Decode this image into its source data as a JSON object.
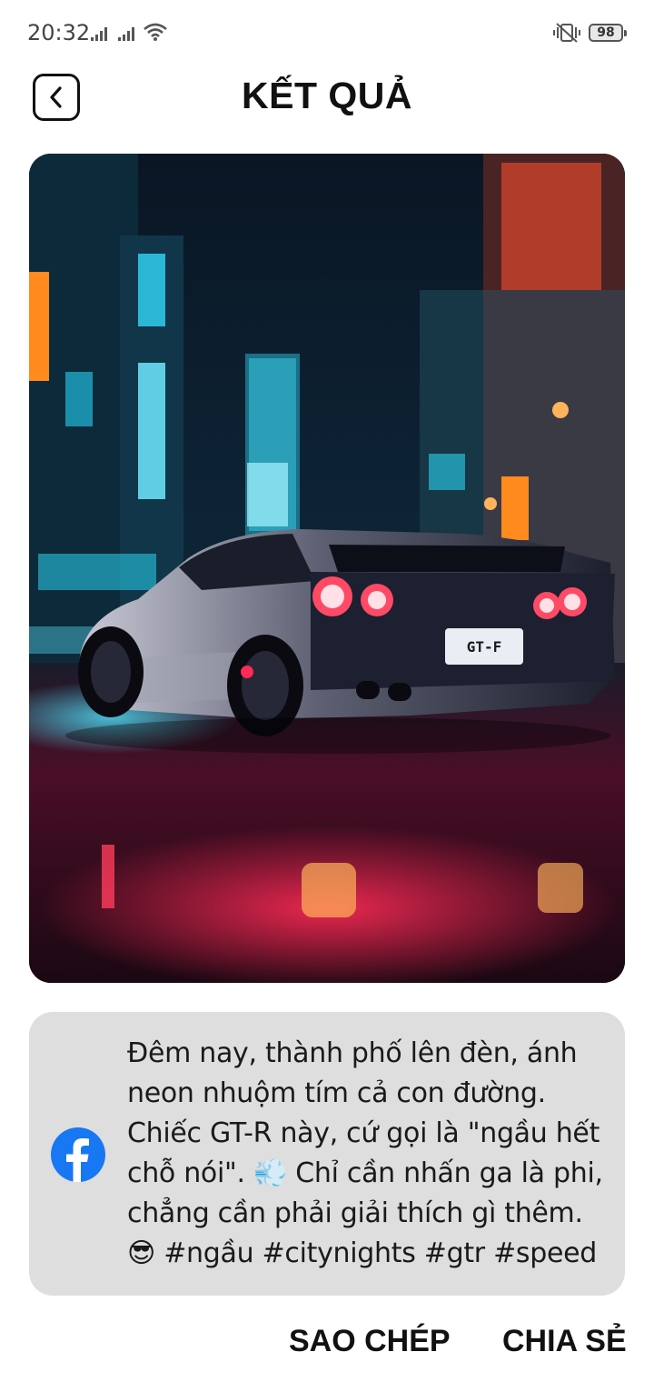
{
  "status_bar": {
    "time": "20:32",
    "battery": "98",
    "icons": [
      "signal-icon",
      "signal-icon",
      "wifi-icon",
      "vibrate-icon",
      "battery-icon"
    ]
  },
  "header": {
    "title": "KẾT QUẢ",
    "back_icon": "chevron-left-icon"
  },
  "result_image": {
    "description_icon": "generated-image",
    "plate_text": "GT-F"
  },
  "caption": {
    "platform_icon": "facebook-icon",
    "text": "Đêm nay, thành phố lên đèn, ánh\nneon nhuộm tím cả con đường.\nChiếc GT-R này, cứ gọi là \"ngầu hết\nchỗ nói\".  💨  Chỉ cần nhấn ga là phi,\nchẳng cần phải giải thích gì thêm.\n😎 #ngầu #citynights #gtr #speed"
  },
  "actions": {
    "copy_label": "SAO CHÉP",
    "share_label": "CHIA SẺ"
  },
  "colors": {
    "card_bg": "#dedede",
    "facebook_blue": "#1877f2",
    "neon_pink": "#ff2a55",
    "neon_cyan": "#29d3f0"
  }
}
